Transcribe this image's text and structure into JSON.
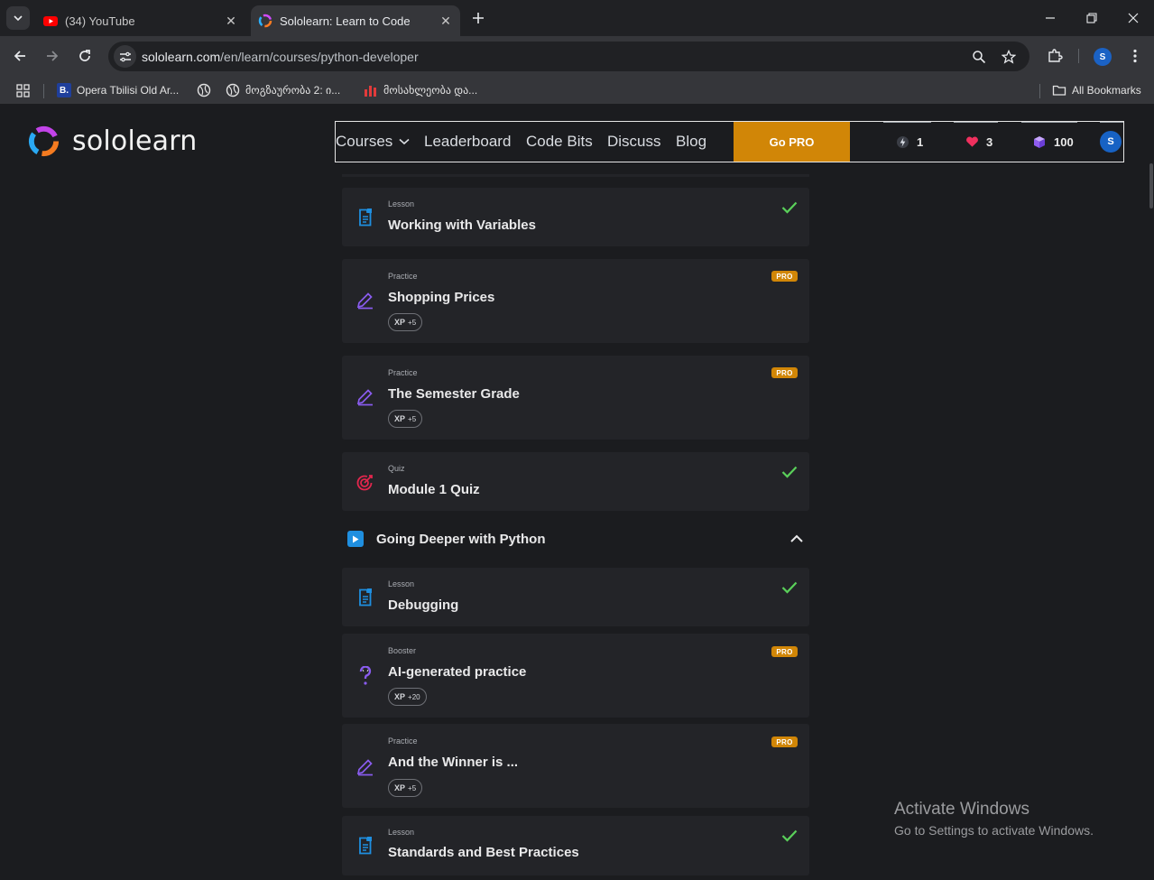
{
  "browser": {
    "tabs": [
      {
        "title": "(34) YouTube",
        "active": false,
        "icon": "youtube-icon"
      },
      {
        "title": "Sololearn: Learn to Code",
        "active": true,
        "icon": "sololearn-icon"
      }
    ],
    "url_host": "sololearn.com",
    "url_path": "/en/learn/courses/python-developer",
    "profile_initial": "S",
    "bookmarks": [
      {
        "label": "Opera Tbilisi Old Ar...",
        "icon": "b-favicon"
      },
      {
        "label": "",
        "icon": "globe-icon"
      },
      {
        "label": "მოგზაურობა 2: ი...",
        "icon": "globe-icon"
      },
      {
        "label": "მოსახლეობა და...",
        "icon": "bar-chart-icon"
      }
    ],
    "all_bookmarks": "All Bookmarks"
  },
  "header": {
    "brand": "sololearn",
    "nav": {
      "courses": "Courses",
      "leaderboard": "Leaderboard",
      "code_bits": "Code Bits",
      "discuss": "Discuss",
      "blog": "Blog"
    },
    "go_pro": "Go PRO",
    "streak": "1",
    "hearts": "3",
    "bits": "100",
    "avatar_initial": "S"
  },
  "colors": {
    "accent_orange": "#d18607",
    "check_green": "#5ad05a",
    "lesson_blue": "#1f8fe0",
    "practice_purple": "#8a5cf0",
    "quiz_red": "#e2264d"
  },
  "items": [
    {
      "kind": "Lesson",
      "title": "Working with Variables",
      "done": true
    },
    {
      "kind": "Practice",
      "title": "Shopping Prices",
      "pro": "PRO",
      "xp_label": "XP",
      "xp_value": "+5"
    },
    {
      "kind": "Practice",
      "title": "The Semester Grade",
      "pro": "PRO",
      "xp_label": "XP",
      "xp_value": "+5"
    },
    {
      "kind": "Quiz",
      "title": "Module 1 Quiz",
      "done": true
    },
    {
      "kind": "Lesson",
      "title": "Debugging",
      "done": true
    },
    {
      "kind": "Booster",
      "title": "AI-generated practice",
      "pro": "PRO",
      "xp_label": "XP",
      "xp_value": "+20"
    },
    {
      "kind": "Practice",
      "title": "And the Winner is ...",
      "pro": "PRO",
      "xp_label": "XP",
      "xp_value": "+5"
    },
    {
      "kind": "Lesson",
      "title": "Standards and Best Practices",
      "done": true
    }
  ],
  "module": {
    "title": "Going Deeper with Python",
    "expanded": true
  },
  "watermark": {
    "line1": "Activate Windows",
    "line2": "Go to Settings to activate Windows."
  }
}
